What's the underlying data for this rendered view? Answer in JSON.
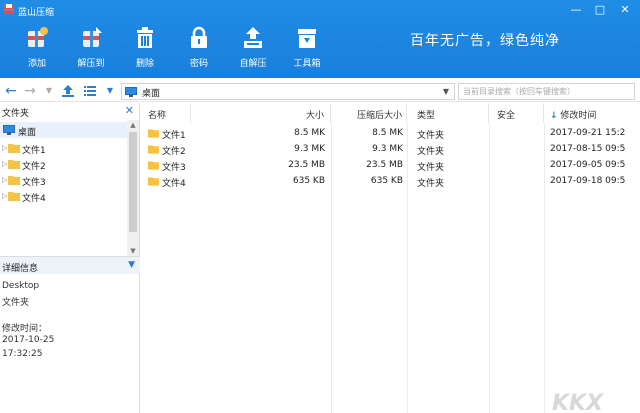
{
  "window": {
    "title": "蓝山压缩",
    "controls": [
      "—",
      "□",
      "✕"
    ]
  },
  "toolbar": {
    "buttons": [
      {
        "label": "添加",
        "icon": "add-archive-icon"
      },
      {
        "label": "解压到",
        "icon": "extract-icon"
      },
      {
        "label": "删除",
        "icon": "trash-icon"
      },
      {
        "label": "密码",
        "icon": "lock-icon"
      },
      {
        "label": "自解压",
        "icon": "self-extract-icon"
      },
      {
        "label": "工具箱",
        "icon": "toolbox-icon"
      }
    ],
    "slogan": "百年无广告，绿色纯净"
  },
  "nav": {
    "path": "桌面",
    "search_placeholder": "当前目录搜索（按回车键搜索）"
  },
  "tree": {
    "header": "文件夹",
    "items": [
      {
        "label": "桌面",
        "type": "desktop"
      },
      {
        "label": "文件1",
        "type": "folder"
      },
      {
        "label": "文件2",
        "type": "folder"
      },
      {
        "label": "文件3",
        "type": "folder"
      },
      {
        "label": "文件4",
        "type": "folder"
      }
    ]
  },
  "details": {
    "header": "详细信息",
    "name": "Desktop",
    "type": "文件夹",
    "modified_label": "修改时间：",
    "modified_date": "2017-10-25",
    "modified_time": "17:32:25"
  },
  "columns": {
    "name": "名称",
    "size": "大小",
    "packed": "压缩后大小",
    "type": "类型",
    "security": "安全",
    "modified": "修改时间"
  },
  "files": [
    {
      "name": "文件1",
      "size": "8.5 MK",
      "packed": "8.5 MK",
      "type": "文件夹",
      "modified": "2017-09-21 15:2"
    },
    {
      "name": "文件2",
      "size": "9.3 MK",
      "packed": "9.3 MK",
      "type": "文件夹",
      "modified": "2017-08-15 09:5"
    },
    {
      "name": "文件3",
      "size": "23.5 MB",
      "packed": "23.5 MB",
      "type": "文件夹",
      "modified": "2017-09-05 09:5"
    },
    {
      "name": "文件4",
      "size": "635 KB",
      "packed": "635 KB",
      "type": "文件夹",
      "modified": "2017-09-18 09:5"
    }
  ],
  "watermark": {
    "text": "KKX"
  },
  "colors": {
    "header_blue": "#1a82dd",
    "folder_yellow": "#f5c342",
    "accent_blue": "#2b7fd0"
  }
}
